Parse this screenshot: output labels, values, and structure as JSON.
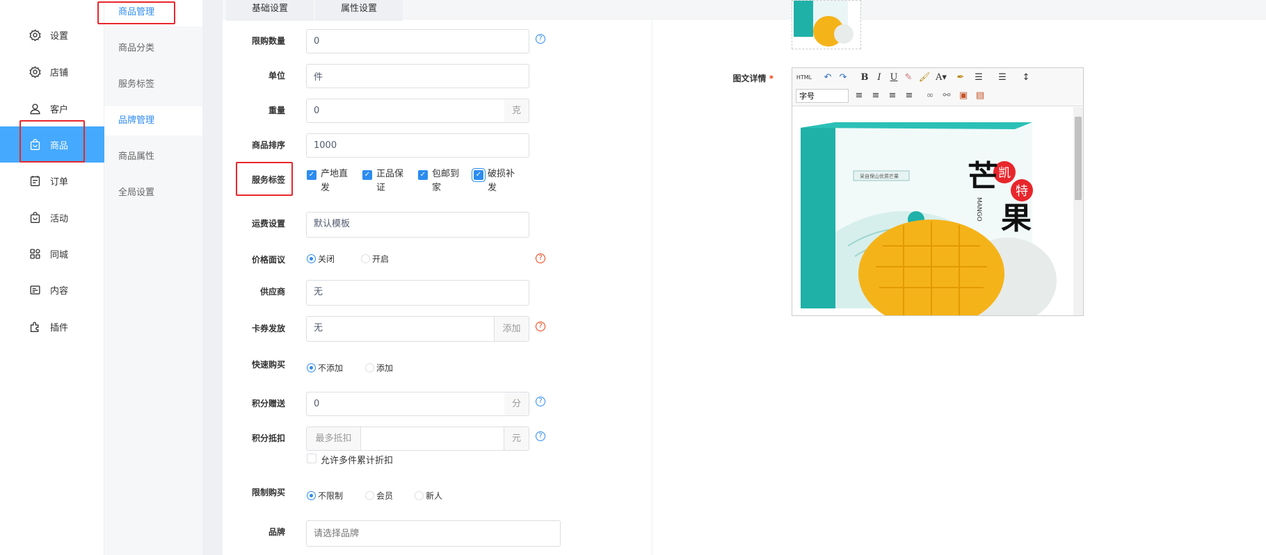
{
  "nav": {
    "items": [
      {
        "label": "设置",
        "icon": "gear-icon"
      },
      {
        "label": "店铺",
        "icon": "store-settings-icon"
      },
      {
        "label": "客户",
        "icon": "user-icon"
      },
      {
        "label": "商品",
        "icon": "shopping-bag-icon"
      },
      {
        "label": "订单",
        "icon": "order-icon"
      },
      {
        "label": "活动",
        "icon": "activity-bag-icon"
      },
      {
        "label": "同城",
        "icon": "grid-apps-icon"
      },
      {
        "label": "内容",
        "icon": "content-icon"
      },
      {
        "label": "插件",
        "icon": "plugin-icon"
      }
    ],
    "active": "商品"
  },
  "subnav": {
    "items": [
      "商品管理",
      "商品分类",
      "服务标签",
      "品牌管理",
      "商品属性",
      "全局设置"
    ],
    "active": [
      "商品管理",
      "品牌管理"
    ]
  },
  "tabs": [
    "基础设置",
    "属性设置"
  ],
  "form": {
    "limit_qty": {
      "label": "限购数量",
      "value": "0"
    },
    "unit": {
      "label": "单位",
      "value": "件"
    },
    "weight": {
      "label": "重量",
      "value": "0",
      "suffix": "克"
    },
    "sort": {
      "label": "商品排序",
      "value": "1000"
    },
    "service_tags": {
      "label": "服务标签",
      "options": [
        {
          "text": "产地直发",
          "checked": true
        },
        {
          "text": "正品保证",
          "checked": true
        },
        {
          "text": "包邮到家",
          "checked": true
        },
        {
          "text": "破损补发",
          "checked": true
        }
      ]
    },
    "shipping": {
      "label": "运费设置",
      "value": "默认模板"
    },
    "price_negotiable": {
      "label": "价格面议",
      "options": [
        "关闭",
        "开启"
      ],
      "selected": "关闭"
    },
    "supplier": {
      "label": "供应商",
      "value": "无"
    },
    "coupon": {
      "label": "卡券发放",
      "value": "无",
      "button": "添加"
    },
    "quick_buy": {
      "label": "快速购买",
      "options": [
        "不添加",
        "添加"
      ],
      "selected": "不添加"
    },
    "points_gift": {
      "label": "积分赠送",
      "value": "0",
      "suffix": "分"
    },
    "points_deduct": {
      "label": "积分抵扣",
      "prefix": "最多抵扣",
      "value": "",
      "suffix": "元",
      "checkbox": "允许多件累计折扣"
    },
    "limit_buy": {
      "label": "限制购买",
      "options": [
        "不限制",
        "会员",
        "新人"
      ],
      "selected": "不限制"
    },
    "brand": {
      "label": "品牌",
      "placeholder": "请选择品牌"
    }
  },
  "detail": {
    "label": "图文详情",
    "required_mark": "*",
    "toolbar": {
      "html": "HTML",
      "bold": "B",
      "italic": "I",
      "underline": "U",
      "font_color": "A",
      "font_size_placeholder": "字号"
    },
    "image_texts": {
      "brand": "凯特",
      "title": "芒果",
      "english": "MANGO",
      "box_note": "采自保山优质芒果"
    }
  },
  "colors": {
    "accent": "#45a9fe",
    "link": "#2d8cf0",
    "highlight": "#e8262c",
    "teal": "#1fb1a8",
    "mango": "#f5b31a"
  }
}
